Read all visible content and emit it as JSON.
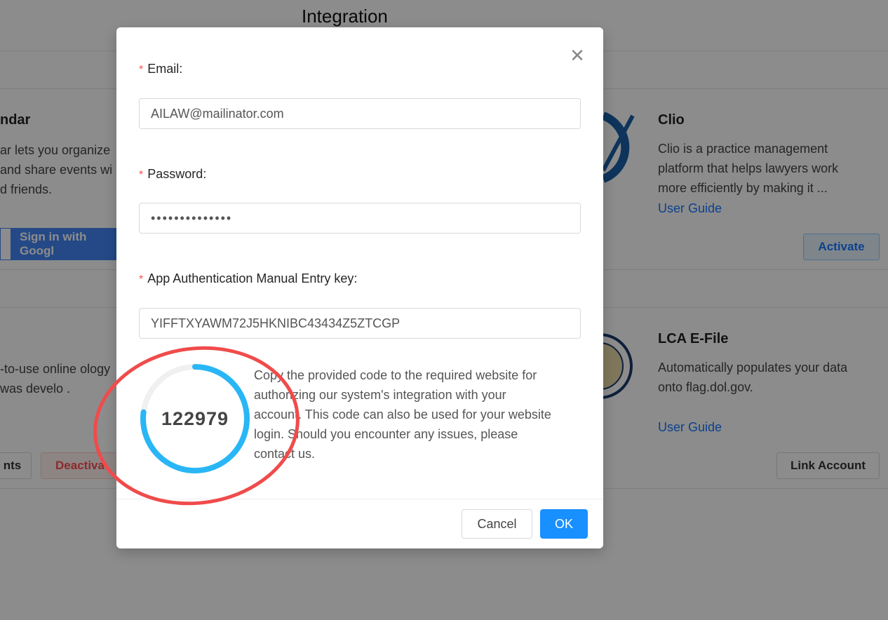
{
  "page": {
    "title": "Integration"
  },
  "background": {
    "left_card_1": {
      "title": "ndar",
      "desc": "ar lets you organize and share events wi d friends.",
      "button": "Sign in with Googl"
    },
    "left_card_2": {
      "desc": "-to-use online ology was develo .",
      "btn_a": "nts",
      "btn_b": "Deactiva"
    },
    "clio": {
      "title": "Clio",
      "desc": "Clio is a practice management platform that helps lawyers work more efficiently by making it ...",
      "link": "User Guide",
      "button": "Activate"
    },
    "lca": {
      "title": "LCA E-File",
      "desc": "Automatically populates your data onto flag.dol.gov.",
      "link": "User Guide",
      "button": "Link Account"
    }
  },
  "modal": {
    "email_label": "Email",
    "email_value": "AILAW@mailinator.com",
    "password_label": "Password",
    "password_value": "••••••••••••••",
    "key_label": "App Authentication Manual Entry key",
    "key_value": "YIFFTXYAWM72J5HKNIBC43434Z5ZTCGP",
    "code": "122979",
    "code_progress": 0.77,
    "instructions": "Copy the provided code to the required website for authorizing our system's integration with your account. This code can also be used for your website login. Should you encounter any issues, please contact us.",
    "cancel_label": "Cancel",
    "ok_label": "OK",
    "close_icon": "close-icon"
  },
  "colors": {
    "accent": "#1890ff",
    "ring": "#29b6f6",
    "annotation": "#f04b4b"
  }
}
